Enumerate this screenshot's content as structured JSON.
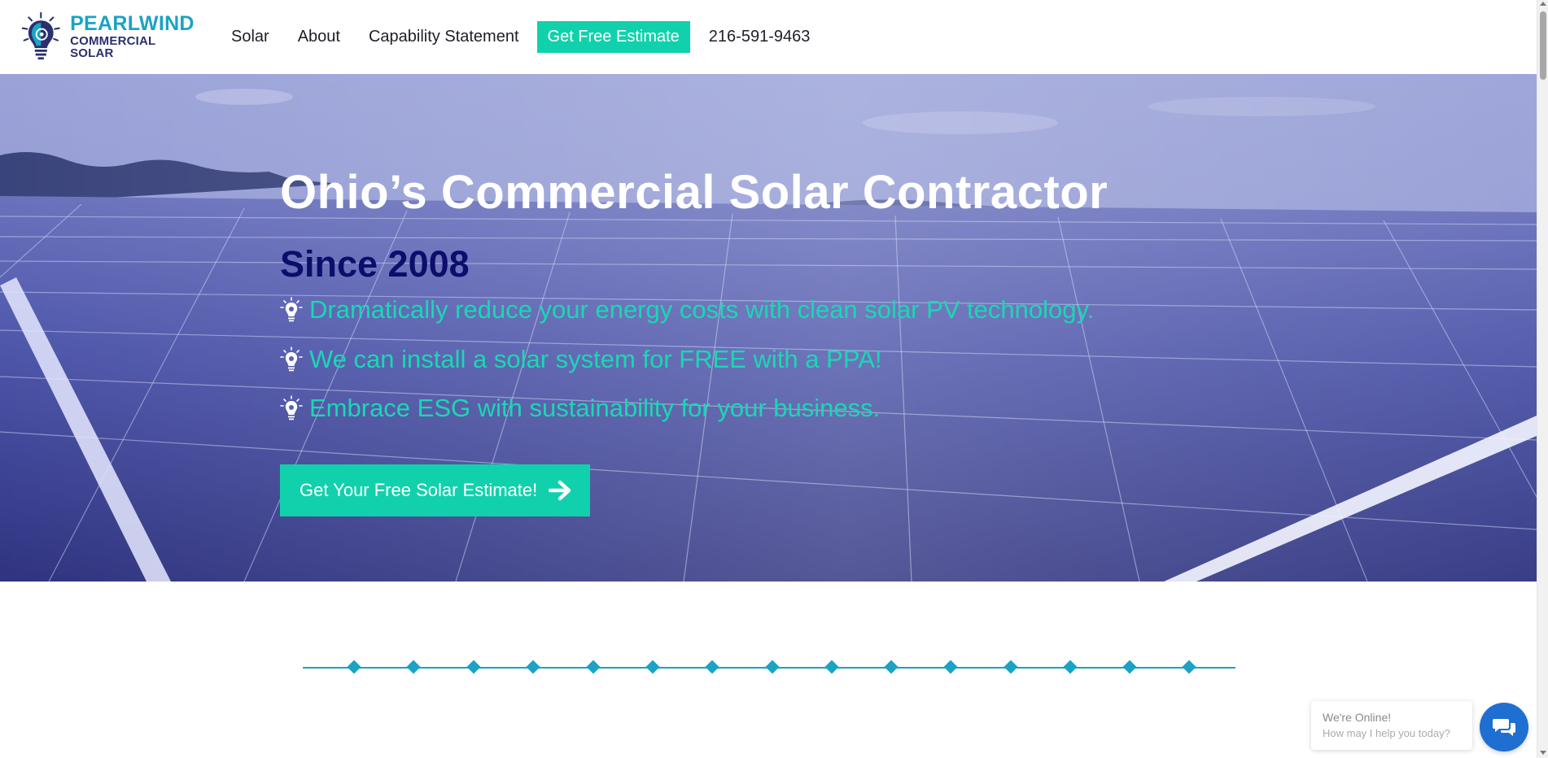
{
  "brand": {
    "name_line1": "PEARLWIND",
    "name_line2": "COMMERCIAL SOLAR"
  },
  "nav": {
    "items": [
      {
        "label": "Solar"
      },
      {
        "label": "About"
      },
      {
        "label": "Capability Statement"
      }
    ],
    "cta_label": "Get Free Estimate",
    "phone": "216-591-9463"
  },
  "hero": {
    "title": "Ohio’s Commercial Solar Contractor",
    "subtitle": "Since 2008",
    "bullets": [
      {
        "text": "Dramatically reduce your energy costs with clean solar PV technology.",
        "icon": "lightbulb-icon"
      },
      {
        "text": "We can install a solar system for FREE with a PPA!",
        "icon": "lightbulb-icon"
      },
      {
        "text": "Embrace ESG with sustainability for your business.",
        "icon": "lightbulb-icon"
      }
    ],
    "button_label": "Get Your Free Solar Estimate!",
    "button_icon": "arrow-right-icon"
  },
  "chat": {
    "status": "We're Online!",
    "prompt": "How may I help you today?",
    "icon": "chat-icon"
  },
  "colors": {
    "accent": "#11d1ac",
    "bullet_text": "#19d8b4",
    "brand_blue": "#1aa3c4",
    "brand_navy": "#2a2f6e",
    "subtitle": "#0d0d6b",
    "chat_button": "#1e6fd1"
  }
}
